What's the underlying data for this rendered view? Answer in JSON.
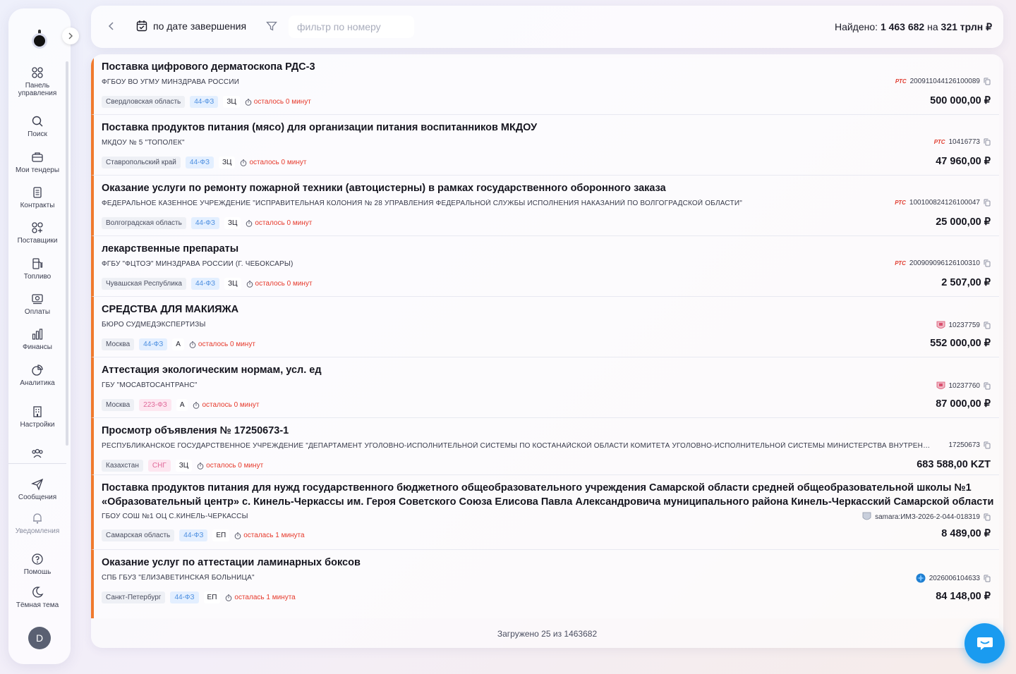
{
  "sidebar": {
    "items": [
      {
        "label": "Панель управления",
        "icon": "dashboard-icon"
      },
      {
        "label": "Поиск",
        "icon": "search-icon"
      },
      {
        "label": "Мои тендеры",
        "icon": "briefcase-icon"
      },
      {
        "label": "Контракты",
        "icon": "documents-icon"
      },
      {
        "label": "Поставщики",
        "icon": "suppliers-icon"
      },
      {
        "label": "Топливо",
        "icon": "fuel-icon"
      },
      {
        "label": "Оплаты",
        "icon": "payments-icon"
      },
      {
        "label": "Финансы",
        "icon": "bar-chart-icon"
      },
      {
        "label": "Аналитика",
        "icon": "pie-chart-icon"
      },
      {
        "label": "Настройки",
        "icon": "building-icon"
      },
      {
        "label": "",
        "icon": "team-icon"
      },
      {
        "label": "Сообщения",
        "icon": "send-icon"
      },
      {
        "label": "Уведомления",
        "icon": "bell-icon"
      },
      {
        "label": "Помощь",
        "icon": "help-icon"
      },
      {
        "label": "Тёмная тема",
        "icon": "moon-icon"
      }
    ],
    "avatar_letter": "D"
  },
  "topbar": {
    "sort_label": "по дате завершения",
    "search_placeholder": "фильтр по номеру",
    "found_prefix": "Найдено: ",
    "found_count": "1 463 682",
    "found_middle": " на ",
    "found_sum": "321 трлн ₽"
  },
  "tenders": [
    {
      "title": "Поставка цифрового дерматоскопа РДС-3",
      "title2": "",
      "org": "ФГБОУ ВО УГМУ МИНЗДРАВА РОССИИ",
      "region": "Свердловская область",
      "law": "44-ФЗ",
      "type": "ЗЦ",
      "time_left": "осталось 0 минут",
      "platform": "РТС",
      "reg_number": "200911044126100089",
      "price": "500 000,00 ₽"
    },
    {
      "title": "Поставка продуктов питания (мясо) для организации питания воспитанников МКДОУ",
      "title2": "",
      "org": "МКДОУ № 5 \"ТОПОЛЕК\"",
      "region": "Ставропольский край",
      "law": "44-ФЗ",
      "type": "ЗЦ",
      "time_left": "осталось 0 минут",
      "platform": "РТС",
      "reg_number": "10416773",
      "price": "47 960,00 ₽"
    },
    {
      "title": "Оказание услуги по ремонту пожарной техники (автоцистерны) в рамках государственного оборонного заказа",
      "title2": "",
      "org": "ФЕДЕРАЛЬНОЕ КАЗЕННОЕ УЧРЕЖДЕНИЕ \"ИСПРАВИТЕЛЬНАЯ КОЛОНИЯ № 28 УПРАВЛЕНИЯ ФЕДЕРАЛЬНОЙ СЛУЖБЫ ИСПОЛНЕНИЯ НАКАЗАНИЙ ПО ВОЛГОГРАДСКОЙ ОБЛАСТИ\"",
      "region": "Волгоградская область",
      "law": "44-ФЗ",
      "type": "ЗЦ",
      "time_left": "осталось 0 минут",
      "platform": "РТС",
      "reg_number": "100100824126100047",
      "price": "25 000,00 ₽"
    },
    {
      "title": "лекарственные препараты",
      "title2": "",
      "org": "ФГБУ \"ФЦТОЭ\" МИНЗДРАВА РОССИИ (Г. ЧЕБОКСАРЫ)",
      "region": "Чувашская Республика",
      "law": "44-ФЗ",
      "type": "ЗЦ",
      "time_left": "осталось 0 минут",
      "platform": "РТС",
      "reg_number": "200909096126100310",
      "price": "2 507,00 ₽"
    },
    {
      "title": "СРЕДСТВА ДЛЯ МАКИЯЖА",
      "title2": "",
      "org": "БЮРО СУДМЕДЭКСПЕРТИЗЫ",
      "region": "Москва",
      "law": "44-ФЗ",
      "type": "А",
      "time_left": "осталось 0 минут",
      "platform": "",
      "reg_number": "10237759",
      "price": "552 000,00 ₽"
    },
    {
      "title": "Аттестация экологическим нормам, усл. ед",
      "title2": "",
      "org": "ГБУ \"МОСАВТОСАНТРАНС\"",
      "region": "Москва",
      "law": "223-ФЗ",
      "type": "А",
      "time_left": "осталось 0 минут",
      "platform": "",
      "reg_number": "10237760",
      "price": "87 000,00 ₽"
    },
    {
      "title": "Просмотр объявления № 17250673-1",
      "title2": "",
      "org": "РЕСПУБЛИКАНСКОЕ ГОСУДАРСТВЕННОЕ УЧРЕЖДЕНИЕ \"ДЕПАРТАМЕНТ УГОЛОВНО-ИСПОЛНИТЕЛЬНОЙ СИСТЕМЫ ПО КОСТАНАЙСКОЙ ОБЛАСТИ КОМИТЕТА УГОЛОВНО-ИСПОЛНИТЕЛЬНОЙ СИСТЕМЫ МИНИСТЕРСТВА ВНУТРЕНН...",
      "region": "Казахстан",
      "law": "СНГ",
      "type": "ЗЦ",
      "time_left": "осталось 0 минут",
      "platform": "",
      "reg_number": "17250673",
      "price": "683 588,00 KZT"
    },
    {
      "title": "Поставка продуктов питания для нужд государственного бюджетного общеобразовательного учреждения Самарской области средней общеобразовательной школы №1",
      "title2": "«Образовательный центр» с. Кинель-Черкассы им. Героя Советского Союза Елисова Павла Александровича муниципального района Кинель-Черкасский Самарской области",
      "org": "ГБОУ СОШ №1 ОЦ С.КИНЕЛЬ-ЧЕРКАССЫ",
      "region": "Самарская область",
      "law": "44-ФЗ",
      "type": "ЕП",
      "time_left": "осталась 1 минута",
      "platform": "",
      "reg_number": "samara:ИМЗ-2026-2-044-018319",
      "price": "8 489,00 ₽"
    },
    {
      "title": "Оказание услуг по аттестации ламинарных боксов",
      "title2": "",
      "org": "СПБ ГБУЗ \"ЕЛИЗАВЕТИНСКАЯ БОЛЬНИЦА\"",
      "region": "Санкт-Петербург",
      "law": "44-ФЗ",
      "type": "ЕП",
      "time_left": "осталась 1 минута",
      "platform": "",
      "reg_number": "2026006104633",
      "price": "84 148,00 ₽"
    }
  ],
  "footer": {
    "loaded": "Загружено 25 из 1463682"
  },
  "colors": {
    "accent": "#f07a2e",
    "urgent": "#e6392b",
    "law_blue": "#4d8fe0",
    "chat": "#1a9bf0"
  }
}
